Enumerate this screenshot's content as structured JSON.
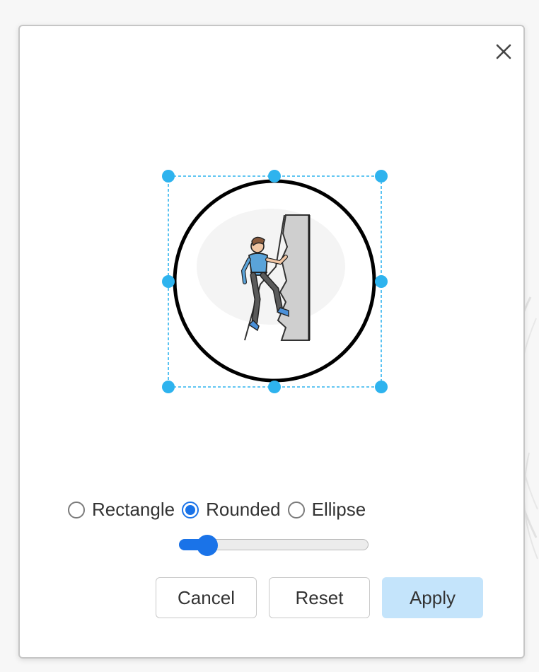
{
  "dialog": {
    "close_icon": "close-icon",
    "image_icon": "rock-climber-illustration"
  },
  "shape_options": {
    "items": [
      {
        "label": "Rectangle",
        "checked": false
      },
      {
        "label": "Rounded",
        "checked": true
      },
      {
        "label": "Ellipse",
        "checked": false
      }
    ]
  },
  "slider": {
    "value_fraction": 0.15
  },
  "buttons": {
    "cancel": "Cancel",
    "reset": "Reset",
    "apply": "Apply"
  },
  "colors": {
    "handle": "#2eb3ee",
    "accent": "#1a73e8",
    "apply_bg": "#c4e4fb"
  }
}
